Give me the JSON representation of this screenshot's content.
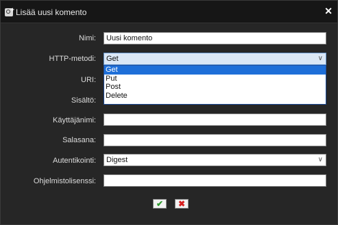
{
  "dialog": {
    "title": "Lisää uusi komento",
    "close_glyph": "✕"
  },
  "form": {
    "name": {
      "label": "Nimi:",
      "value": "Uusi komento"
    },
    "http_method": {
      "label": "HTTP-metodi:",
      "value": "Get",
      "options": [
        "Get",
        "Put",
        "Post",
        "Delete"
      ],
      "selected_index": 0
    },
    "uri": {
      "label": "URI:",
      "value": ""
    },
    "content": {
      "label": "Sisältö:",
      "value": ""
    },
    "username": {
      "label": "Käyttäjänimi:",
      "value": ""
    },
    "password": {
      "label": "Salasana:",
      "value": ""
    },
    "authentication": {
      "label": "Autentikointi:",
      "value": "Digest"
    },
    "license": {
      "label": "Ohjelmistolisenssi:",
      "value": ""
    }
  },
  "buttons": {
    "ok_glyph": "✔",
    "cancel_glyph": "✖"
  },
  "icons": {
    "title": "settings-add-icon",
    "close": "close-icon",
    "dropdown": "chevron-down-icon",
    "ok": "checkmark-icon",
    "cancel": "cross-icon"
  },
  "colors": {
    "dialog_bg": "#262626",
    "titlebar_bg": "#161616",
    "selection": "#1e6fd8",
    "ok": "#2f9b2f",
    "cancel": "#d81f1f"
  }
}
